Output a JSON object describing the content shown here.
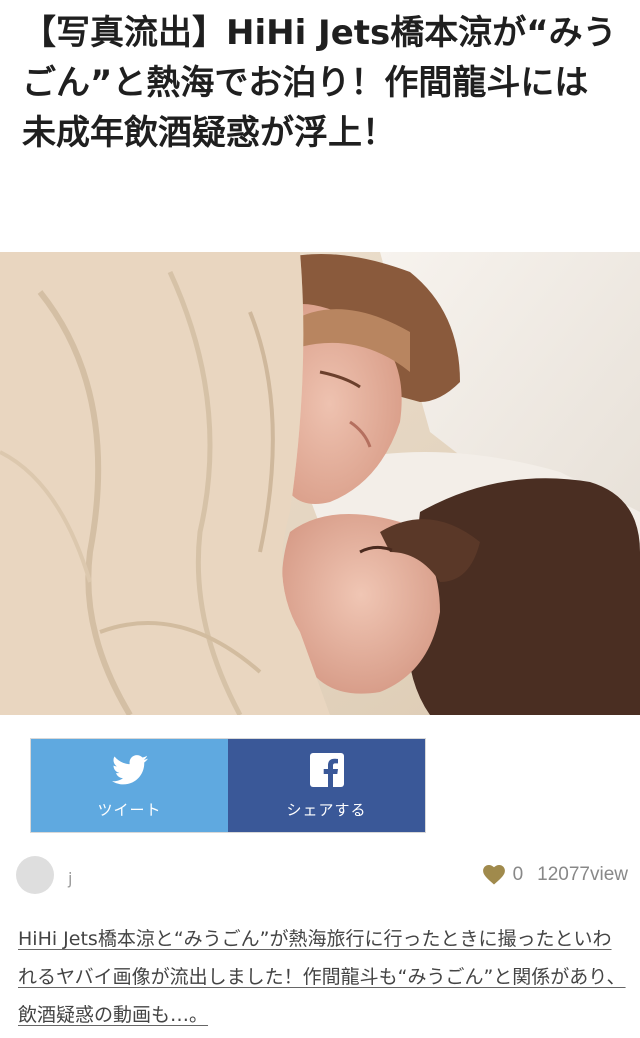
{
  "article": {
    "headline": "【写真流出】HiHi Jets橋本涼が“みうごん”と熱海でお泊り！作間龍斗には未成年飲酒疑惑が浮上！",
    "photo_icon": "photo-two-people-in-bed"
  },
  "share": {
    "twitter_label": "ツイート",
    "twitter_icon": "twitter-bird-icon",
    "twitter_color": "#5fa9e0",
    "facebook_label": "シェアする",
    "facebook_icon": "facebook-f-icon",
    "facebook_color": "#3a5898"
  },
  "meta": {
    "author": "j",
    "likes": "0",
    "views": "12077view",
    "heart_color": "#a08a4c"
  },
  "excerpt": {
    "text": "HiHi Jets橋本涼と“みうごん”が熱海旅行に行ったときに撮ったといわれるヤバイ画像が流出しました！作間龍斗も“みうごん”と関係があり、飲酒疑惑の動画も…。"
  }
}
